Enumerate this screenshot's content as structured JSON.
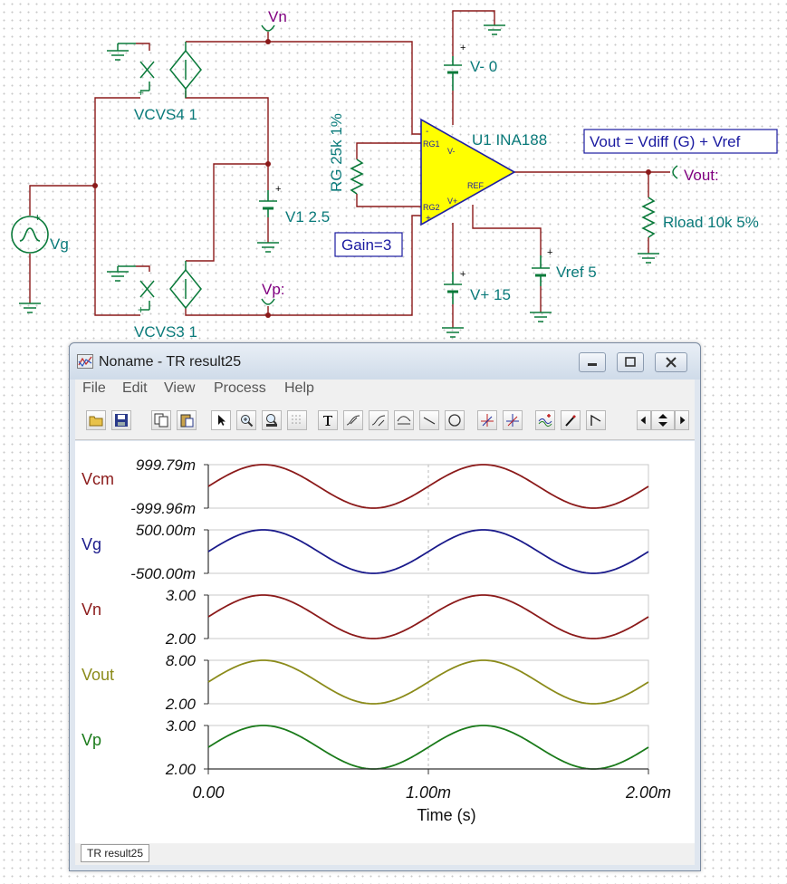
{
  "schematic": {
    "labels": {
      "vn": "Vn",
      "vp": "Vp:",
      "vout": "Vout:",
      "vg": "Vg",
      "vcvs4": "VCVS4 1",
      "vcvs3": "VCVS3 1",
      "v1": "V1 2.5",
      "vminus": "V- 0",
      "vplus": "V+ 15",
      "vref": "Vref 5",
      "rg": "RG 25k 1%",
      "rload": "Rload 10k 5%",
      "u1": "U1 INA188",
      "equation": "Vout = Vdiff (G) + Vref",
      "gain": "Gain=3",
      "pin_rg1": "RG1",
      "pin_rg2": "RG2",
      "pin_vminus": "V-",
      "pin_vplus": "V+",
      "pin_ref": "REF",
      "plus": "+",
      "minus": "-"
    },
    "colors": {
      "wire": "#8b1a1a",
      "component": "#0a7a3a",
      "label": "#0a7a7a",
      "node_label": "#800080",
      "opamp_fill": "#ffff00",
      "opamp_stroke": "#2020a0",
      "box_border": "#1a1aa0"
    }
  },
  "window": {
    "title": "Noname - TR result25",
    "menu": [
      "File",
      "Edit",
      "View",
      "Process",
      "Help"
    ],
    "toolbar_icons": [
      "open-folder-icon",
      "save-icon",
      "copy-icon",
      "paste-icon",
      "pointer-icon",
      "zoom-in-icon",
      "zoom-100-icon",
      "grid-icon",
      "text-icon",
      "curve-a-icon",
      "curve-b-icon",
      "curve-c-icon",
      "line-icon",
      "circle-icon",
      "cursor-a-icon",
      "cursor-b-icon",
      "wave-add-icon",
      "pen-icon",
      "flag-icon",
      "scroll-arrows-icon"
    ],
    "status_tab": "TR result25"
  },
  "chart_data": {
    "type": "line",
    "xlabel": "Time (s)",
    "x_ticks": [
      "0.00",
      "1.00m",
      "2.00m"
    ],
    "xlim": [
      0,
      0.002
    ],
    "signal_period": 0.001,
    "series": [
      {
        "name": "Vcm",
        "y_top_label": "999.79m",
        "y_bottom_label": "-999.96m",
        "ylim": [
          -1.0,
          1.0
        ],
        "offset": 0.0,
        "amplitude": 1.0,
        "color": "#8b1a1a"
      },
      {
        "name": "Vg",
        "y_top_label": "500.00m",
        "y_bottom_label": "-500.00m",
        "ylim": [
          -0.5,
          0.5
        ],
        "offset": 0.0,
        "amplitude": 0.5,
        "color": "#1a1a8b"
      },
      {
        "name": "Vn",
        "y_top_label": "3.00",
        "y_bottom_label": "2.00",
        "ylim": [
          2.0,
          3.0
        ],
        "offset": 2.5,
        "amplitude": 0.5,
        "color": "#8b1a1a"
      },
      {
        "name": "Vout",
        "y_top_label": "8.00",
        "y_bottom_label": "2.00",
        "ylim": [
          2.0,
          8.0
        ],
        "offset": 5.0,
        "amplitude": 3.0,
        "color": "#8b8b1a"
      },
      {
        "name": "Vp",
        "y_top_label": "3.00",
        "y_bottom_label": "2.00",
        "ylim": [
          2.0,
          3.0
        ],
        "offset": 2.5,
        "amplitude": 0.5,
        "color": "#1a7a1a"
      }
    ]
  }
}
